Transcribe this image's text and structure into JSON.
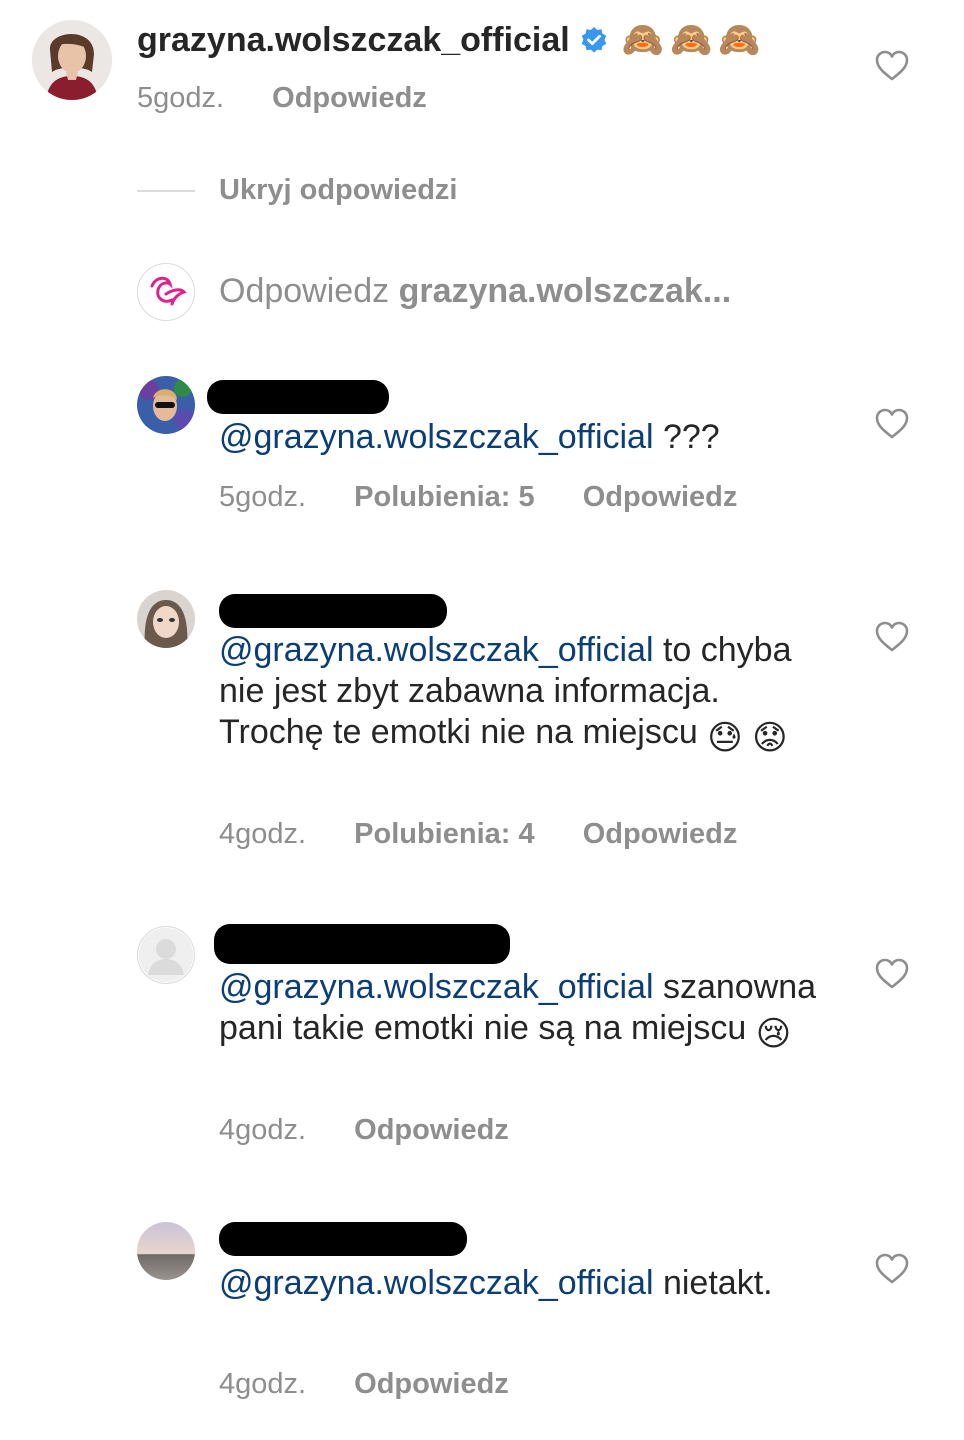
{
  "top_comment": {
    "username": "grazyna.wolszczak_official",
    "verified": true,
    "emoji": "🙈🙈🙈",
    "time": "5godz.",
    "reply": "Odpowiedz"
  },
  "hide_replies": "Ukryj odpowiedzi",
  "reply_input": {
    "prefix": "Odpowiedz",
    "target": "grazyna.wolszczak..."
  },
  "replies": [
    {
      "username": "",
      "mention": "@grazyna.wolszczak_official",
      "text": " ???",
      "time": "5godz.",
      "likes": "Polubienia: 5",
      "reply": "Odpowiedz"
    },
    {
      "username": "",
      "mention": "@grazyna.wolszczak_official",
      "text": " to chyba nie jest zbyt zabawna informacja. Trochę te emotki nie na miejscu",
      "emoji": "😓 😟",
      "time": "4godz.",
      "likes": "Polubienia: 4",
      "reply": "Odpowiedz"
    },
    {
      "username": "",
      "mention": "@grazyna.wolszczak_official",
      "text": " szanowna pani takie emotki nie są na miejscu",
      "emoji": "😢",
      "time": "4godz.",
      "reply": "Odpowiedz"
    },
    {
      "username": "",
      "mention": "@grazyna.wolszczak_official",
      "text": " nietakt.",
      "time": "4godz.",
      "reply": "Odpowiedz"
    }
  ],
  "colors": {
    "text": "#262626",
    "muted": "#8e8e8e",
    "mention": "#0b3d76",
    "verified": "#3897f0",
    "brand_pink": "#e0218a"
  },
  "icons": [
    "heart-outline-icon",
    "verified-badge-icon",
    "avatar-placeholder-icon"
  ]
}
